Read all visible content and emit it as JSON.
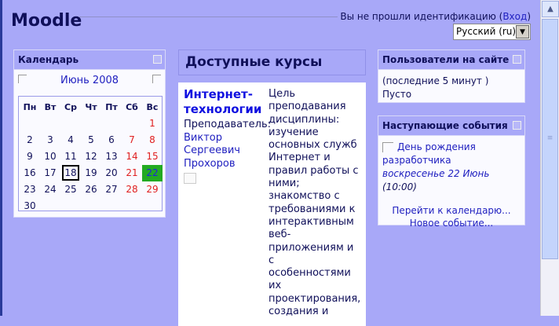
{
  "header": {
    "title": "Moodle",
    "login_text": "Вы не прошли идентификацию",
    "login_link": "Вход",
    "language": "Русский (ru)"
  },
  "calendar": {
    "title": "Календарь",
    "month": "Июнь 2008",
    "weekdays": [
      "Пн",
      "Вт",
      "Ср",
      "Чт",
      "Пт",
      "Сб",
      "Вс"
    ],
    "today": "18",
    "event_day": "22"
  },
  "courses": {
    "title": "Доступные курсы",
    "name": "Интернет-технологии",
    "teacher_label": "Преподаватель:",
    "teacher": [
      "Виктор",
      "Сергеевич",
      "Прохоров"
    ],
    "description_lines": [
      "Цель",
      "преподавания",
      "дисциплины:",
      "изучение",
      "основных служб",
      "Интернет и",
      "правил работы с",
      "ними;",
      "знакомство с",
      "требованиями к",
      "интерактивным",
      "веб-",
      "приложениям и",
      "с",
      "особенностями",
      "их",
      "проектирования,",
      "создания и"
    ]
  },
  "users": {
    "title": "Пользователи на сайте",
    "period": "(последние 5 минут )",
    "status": "Пусто"
  },
  "events": {
    "title": "Наступающие события",
    "event_name": "День рождения разработчика",
    "event_date": "воскресенье 22 Июнь",
    "event_time": "(10:00)",
    "goto_calendar": "Перейти к календарю...",
    "new_event": "Новое событие..."
  }
}
